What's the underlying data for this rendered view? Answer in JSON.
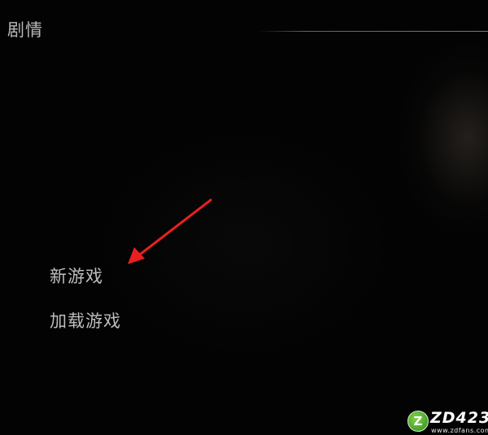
{
  "header": {
    "title": "剧情"
  },
  "menu": {
    "items": [
      {
        "label": "新游戏"
      },
      {
        "label": "加载游戏"
      }
    ]
  },
  "annotation": {
    "arrow_color": "#e8201e"
  },
  "watermark": {
    "badge": "Z",
    "brand": "ZD423",
    "url": "www.zdfans.com"
  }
}
